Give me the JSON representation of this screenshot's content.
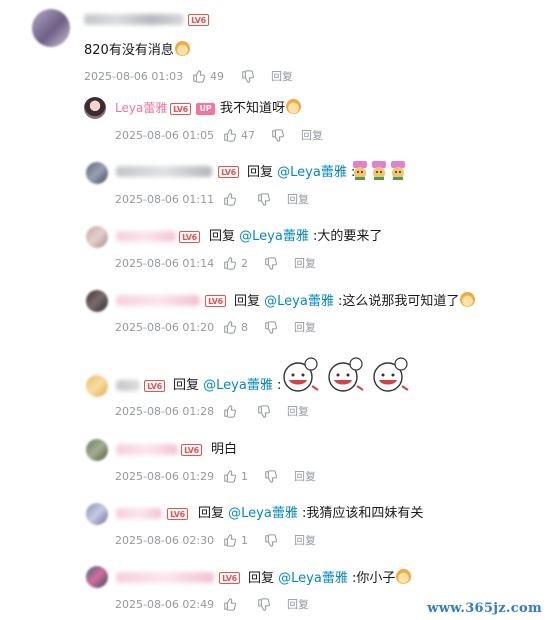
{
  "root": {
    "text": "820有没有消息",
    "time": "2025-08-06 01:03",
    "likes": "49",
    "reply_label": "回复"
  },
  "sub_user": {
    "name": "Leya蕾雅",
    "level": "LV6",
    "up_badge": "UP",
    "text": "我不知道呀",
    "time": "2025-08-06 01:05",
    "likes": "47",
    "reply_label": "回复"
  },
  "replies": [
    {
      "prefix": "回复 ",
      "mention": "@Leya蕾雅",
      "text": " :",
      "time": "2025-08-06 01:11",
      "likes": "",
      "reply_label": "回复"
    },
    {
      "prefix": "回复 ",
      "mention": "@Leya蕾雅",
      "text": " :大的要来了",
      "time": "2025-08-06 01:14",
      "likes": "2",
      "reply_label": "回复"
    },
    {
      "prefix": "回复 ",
      "mention": "@Leya蕾雅",
      "text": " :这么说那我可知道了",
      "time": "2025-08-06 01:20",
      "likes": "8",
      "reply_label": "回复"
    },
    {
      "prefix": "回复 ",
      "mention": "@Leya蕾雅",
      "text": " :",
      "time": "2025-08-06 01:28",
      "likes": "",
      "reply_label": "回复"
    },
    {
      "prefix": "",
      "mention": "",
      "text": "明白",
      "time": "2025-08-06 01:29",
      "likes": "1",
      "reply_label": "回复"
    },
    {
      "prefix": "回复 ",
      "mention": "@Leya蕾雅",
      "text": " :我猜应该和四妹有关",
      "time": "2025-08-06 02:30",
      "likes": "1",
      "reply_label": "回复"
    },
    {
      "prefix": "回复 ",
      "mention": "@Leya蕾雅",
      "text": " :你小子",
      "time": "2025-08-06 02:49",
      "likes": "",
      "reply_label": "回复"
    }
  ],
  "level_badge": "LV6",
  "watermark": "www.365jz.com",
  "colors": {
    "mention": "#008ac5",
    "meta": "#9499a0",
    "level": "#f44d4d",
    "up": "#fb7299"
  }
}
